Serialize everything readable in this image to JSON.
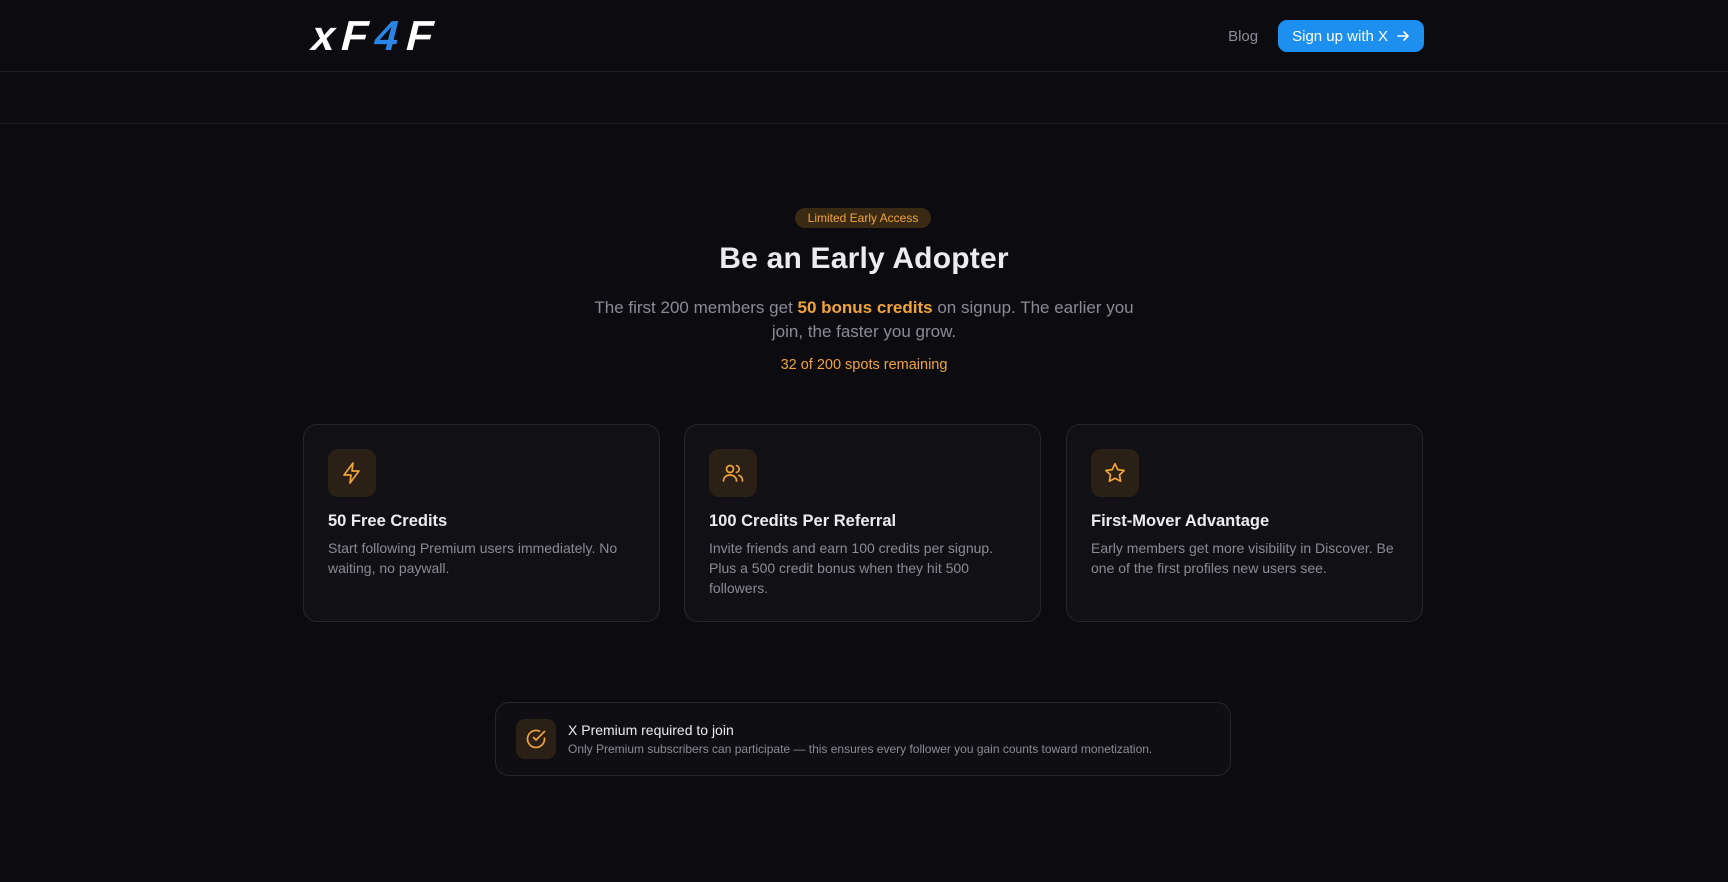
{
  "header": {
    "logo_text": "xF4F",
    "nav": {
      "blog_label": "Blog"
    },
    "cta_label": "Sign up with X"
  },
  "hero": {
    "badge": "Limited Early Access",
    "title": "Be an Early Adopter",
    "subtitle_before": "The first 200 members get ",
    "subtitle_highlight": "50 bonus credits",
    "subtitle_after": " on signup. The earlier you join, the faster you grow.",
    "spots_remaining": "32 of 200 spots remaining"
  },
  "cards": [
    {
      "icon": "lightning-icon",
      "title": "50 Free Credits",
      "description": "Start following Premium users immediately. No waiting, no paywall."
    },
    {
      "icon": "users-icon",
      "title": "100 Credits Per Referral",
      "description": "Invite friends and earn 100 credits per signup. Plus a 500 credit bonus when they hit 500 followers."
    },
    {
      "icon": "star-icon",
      "title": "First-Mover Advantage",
      "description": "Early members get more visibility in Discover. Be one of the first profiles new users see."
    }
  ],
  "notice": {
    "icon": "check-circle-icon",
    "title": "X Premium required to join",
    "subtitle": "Only Premium subscribers can participate — this ensures every follower you gain counts toward monetization."
  },
  "colors": {
    "background": "#0c0c10",
    "accent_orange": "#f0a43a",
    "cta_blue": "#1d8fef",
    "logo_blue": "#2a86e6"
  }
}
